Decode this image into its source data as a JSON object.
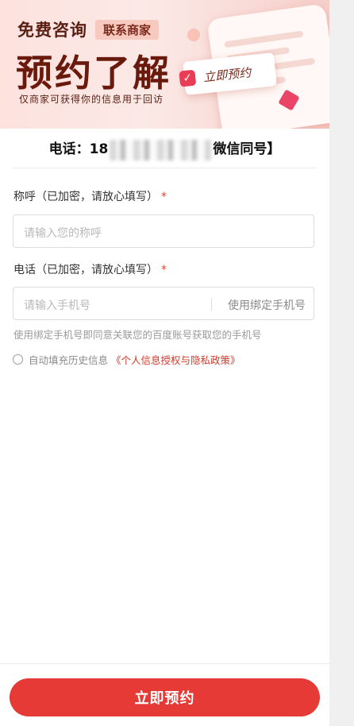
{
  "banner": {
    "free_consult": "免费咨询",
    "contact_merchant": "联系商家",
    "headline": "预约了解",
    "subtitle": "仅商家可获得你的信息用于回访",
    "card_label": "立即预约",
    "card_check_icon": "check-icon"
  },
  "phone": {
    "prefix": "电话：18",
    "suffix": "微信同号】"
  },
  "form": {
    "name_label": "称呼（已加密，请放心填写）",
    "name_required": "*",
    "name_placeholder": "请输入您的称呼",
    "phone_label": "电话（已加密，请放心填写）",
    "phone_required": "*",
    "phone_placeholder": "请输入手机号",
    "bind_phone": "使用绑定手机号",
    "hint": "使用绑定手机号即同意关联您的百度账号获取您的手机号",
    "autofill": "自动填充历史信息",
    "policy": "《个人信息授权与隐私政策》"
  },
  "submit": "立即预约",
  "colors": {
    "primary": "#e53a35",
    "required": "#e0463a",
    "policy": "#d23b2c",
    "headline": "#6a1a0c"
  }
}
